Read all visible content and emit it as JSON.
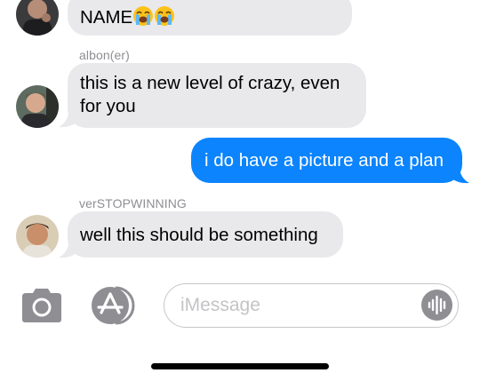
{
  "conversation": {
    "messages": [
      {
        "direction": "incoming",
        "sender": "",
        "text": "NAME",
        "emoji": [
          "loudly-crying-face",
          "loudly-crying-face"
        ],
        "avatar": "avatar-1"
      },
      {
        "direction": "incoming",
        "sender": "albon(er)",
        "text": "this is a new level of crazy, even for you",
        "avatar": "avatar-2"
      },
      {
        "direction": "outgoing",
        "sender": "",
        "text": "i do have a picture and a plan"
      },
      {
        "direction": "incoming",
        "sender": "verSTOPWINNING",
        "text": "well this should be something",
        "avatar": "avatar-3"
      }
    ]
  },
  "composer": {
    "placeholder": "iMessage",
    "camera_icon": "camera-icon",
    "apps_icon": "app-store-icon",
    "audio_icon": "audio-waveform-icon"
  },
  "colors": {
    "outgoing_bubble": "#0b84fe",
    "incoming_bubble": "#e9e9eb",
    "sender_label": "#8e8e93",
    "toolbar_icon": "#8e8e93"
  }
}
